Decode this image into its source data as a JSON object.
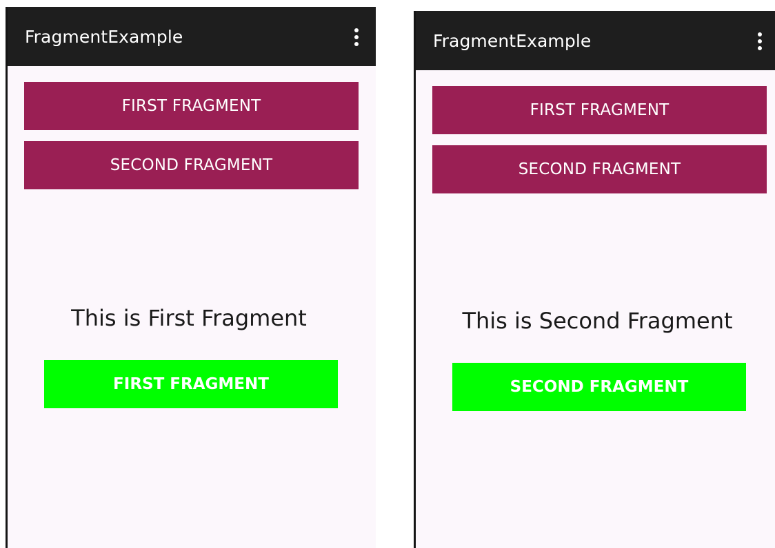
{
  "screens": [
    {
      "app_title": "FragmentExample",
      "menu_icon": "overflow-menu-icon",
      "nav_buttons": [
        "FIRST FRAGMENT",
        "SECOND FRAGMENT"
      ],
      "fragment_text": "This is First Fragment",
      "fragment_button": "FIRST FRAGMENT"
    },
    {
      "app_title": "FragmentExample",
      "menu_icon": "overflow-menu-icon",
      "nav_buttons": [
        "FIRST FRAGMENT",
        "SECOND FRAGMENT"
      ],
      "fragment_text": "This is Second Fragment",
      "fragment_button": "SECOND FRAGMENT"
    }
  ],
  "colors": {
    "action_bar": "#1e1e1e",
    "nav_button": "#9a1f54",
    "fragment_button": "#00ff00",
    "background": "#fcf7fc"
  }
}
